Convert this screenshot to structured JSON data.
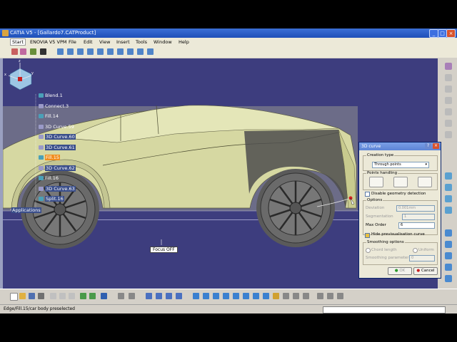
{
  "window": {
    "title": "CATIA V5 - [Gallardo7.CATProduct]"
  },
  "menubar": {
    "items": [
      "Start",
      "ENOVIA V5 VPM",
      "File",
      "Edit",
      "View",
      "Insert",
      "Tools",
      "Window",
      "Help"
    ]
  },
  "tree": {
    "items": [
      {
        "label": "Blend.1"
      },
      {
        "label": "Connect.3"
      },
      {
        "label": "Fill.14"
      },
      {
        "label": "3D Curve.59"
      },
      {
        "label": "3D Curve.60"
      },
      {
        "label": "3D Curve.61"
      },
      {
        "label": "Fill.15"
      },
      {
        "label": "3D Curve.62"
      },
      {
        "label": "Fill.16"
      },
      {
        "label": "3D Curve.63"
      },
      {
        "label": "Split.16"
      }
    ],
    "root_label": "Applications"
  },
  "viewport": {
    "focus_label": "Focus OFF",
    "compass": {
      "z": "z",
      "x": "x",
      "y": "y"
    }
  },
  "dialog": {
    "title": "3D curve",
    "creation_type_label": "Creation type",
    "creation_type_value": "Through points",
    "points_handling_label": "Points handling",
    "disable_detection_label": "Disable geometry detection",
    "options_label": "Options",
    "deviation_label": "Deviation",
    "deviation_value": "0.001mm",
    "segmentation_label": "Segmentation",
    "segmentation_value": "1",
    "max_order_label": "Max Order",
    "max_order_value": "6",
    "hide_preview_label": "Hide previsualisation curve",
    "smoothing_label": "Smoothing options",
    "chord_length_label": "Chord length",
    "uniform_label": "Uniform",
    "smoothing_param_label": "Smoothing parameter",
    "smoothing_param_value": "0",
    "ok_label": "OK",
    "cancel_label": "Cancel"
  },
  "status": {
    "text": "Edge/Fill.15/car body preselected"
  },
  "colors": {
    "viewport_bg": "#3d3d7e",
    "car_body": "#d6d8a2",
    "highlight": "#f08d1e",
    "title_blue": "#1f4fb8"
  }
}
